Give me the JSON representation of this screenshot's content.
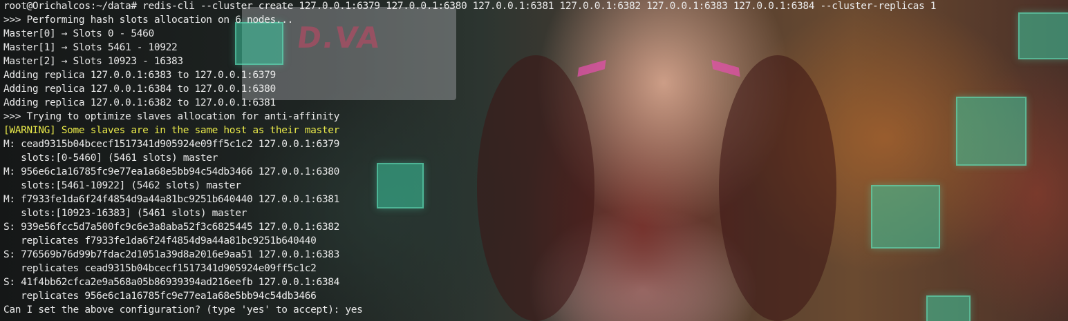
{
  "terminal": {
    "colors": {
      "text": "#e9e9e9",
      "warning": "#e9e94a"
    },
    "lines": [
      "root@Orichalcos:~/data# redis-cli --cluster create 127.0.0.1:6379 127.0.0.1:6380 127.0.0.1:6381 127.0.0.1:6382 127.0.0.1:6383 127.0.0.1:6384 --cluster-replicas 1",
      ">>> Performing hash slots allocation on 6 nodes...",
      "Master[0] → Slots 0 - 5460",
      "Master[1] → Slots 5461 - 10922",
      "Master[2] → Slots 10923 - 16383",
      "Adding replica 127.0.0.1:6383 to 127.0.0.1:6379",
      "Adding replica 127.0.0.1:6384 to 127.0.0.1:6380",
      "Adding replica 127.0.0.1:6382 to 127.0.0.1:6381",
      ">>> Trying to optimize slaves allocation for anti-affinity",
      "[WARNING] Some slaves are in the same host as their master",
      "M: cead9315b04bcecf1517341d905924e09ff5c1c2 127.0.0.1:6379",
      "   slots:[0-5460] (5461 slots) master",
      "M: 956e6c1a16785fc9e77ea1a68e5bb94c54db3466 127.0.0.1:6380",
      "   slots:[5461-10922] (5462 slots) master",
      "M: f7933fe1da6f24f4854d9a44a81bc9251b640440 127.0.0.1:6381",
      "   slots:[10923-16383] (5461 slots) master",
      "S: 939e56fcc5d7a500fc9c6e3a8aba52f3c6825445 127.0.0.1:6382",
      "   replicates f7933fe1da6f24f4854d9a44a81bc9251b640440",
      "S: 776569b76d99b7fdac2d1051a39d8a2016e9aa51 127.0.0.1:6383",
      "   replicates cead9315b04bcecf1517341d905924e09ff5c1c2",
      "S: 41f4bb62cfca2e9a568a05b86939394ad216eefb 127.0.0.1:6384",
      "   replicates 956e6c1a16785fc9e77ea1a68e5bb94c54db3466",
      "Can I set the above configuration? (type 'yes' to accept): yes"
    ]
  }
}
